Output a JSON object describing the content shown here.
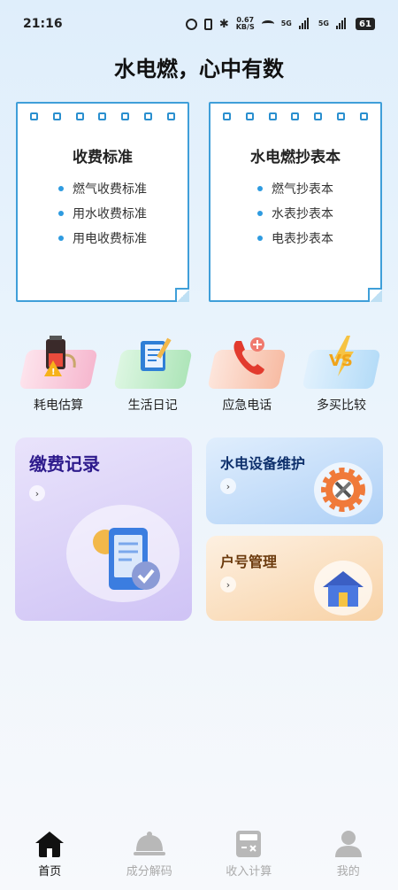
{
  "status_bar": {
    "time": "21:16",
    "network_speed": "0.67",
    "network_unit": "KB/S",
    "signal1": "5G",
    "signal2": "5G",
    "battery": "61"
  },
  "page_title": "水电燃，心中有数",
  "notes": [
    {
      "title": "收费标准",
      "items": [
        "燃气收费标准",
        "用水收费标准",
        "用电收费标准"
      ]
    },
    {
      "title": "水电燃抄表本",
      "items": [
        "燃气抄表本",
        "水表抄表本",
        "电表抄表本"
      ]
    }
  ],
  "quick_actions": [
    {
      "label": "耗电估算",
      "icon": "battery-warning-icon",
      "bg": "#f9c7d9"
    },
    {
      "label": "生活日记",
      "icon": "notebook-icon",
      "bg": "#c8efcf"
    },
    {
      "label": "应急电话",
      "icon": "phone-icon",
      "bg": "#fbd3c3"
    },
    {
      "label": "多买比较",
      "icon": "vs-icon",
      "bg": "#c9e6fa"
    }
  ],
  "cards": {
    "payment_record": {
      "title": "缴费记录",
      "arrow": "›"
    },
    "equipment_maintenance": {
      "title": "水电设备维护",
      "arrow": "›"
    },
    "account_management": {
      "title": "户号管理",
      "arrow": "›"
    }
  },
  "tabbar": [
    {
      "label": "首页",
      "icon": "home-icon",
      "active": true
    },
    {
      "label": "成分解码",
      "icon": "cloche-icon",
      "active": false
    },
    {
      "label": "收入计算",
      "icon": "calculator-icon",
      "active": false
    },
    {
      "label": "我的",
      "icon": "user-icon",
      "active": false
    }
  ],
  "colors": {
    "accent": "#2e9be0",
    "note_border": "#3f9fd9",
    "pay_title": "#2d1a8c"
  }
}
